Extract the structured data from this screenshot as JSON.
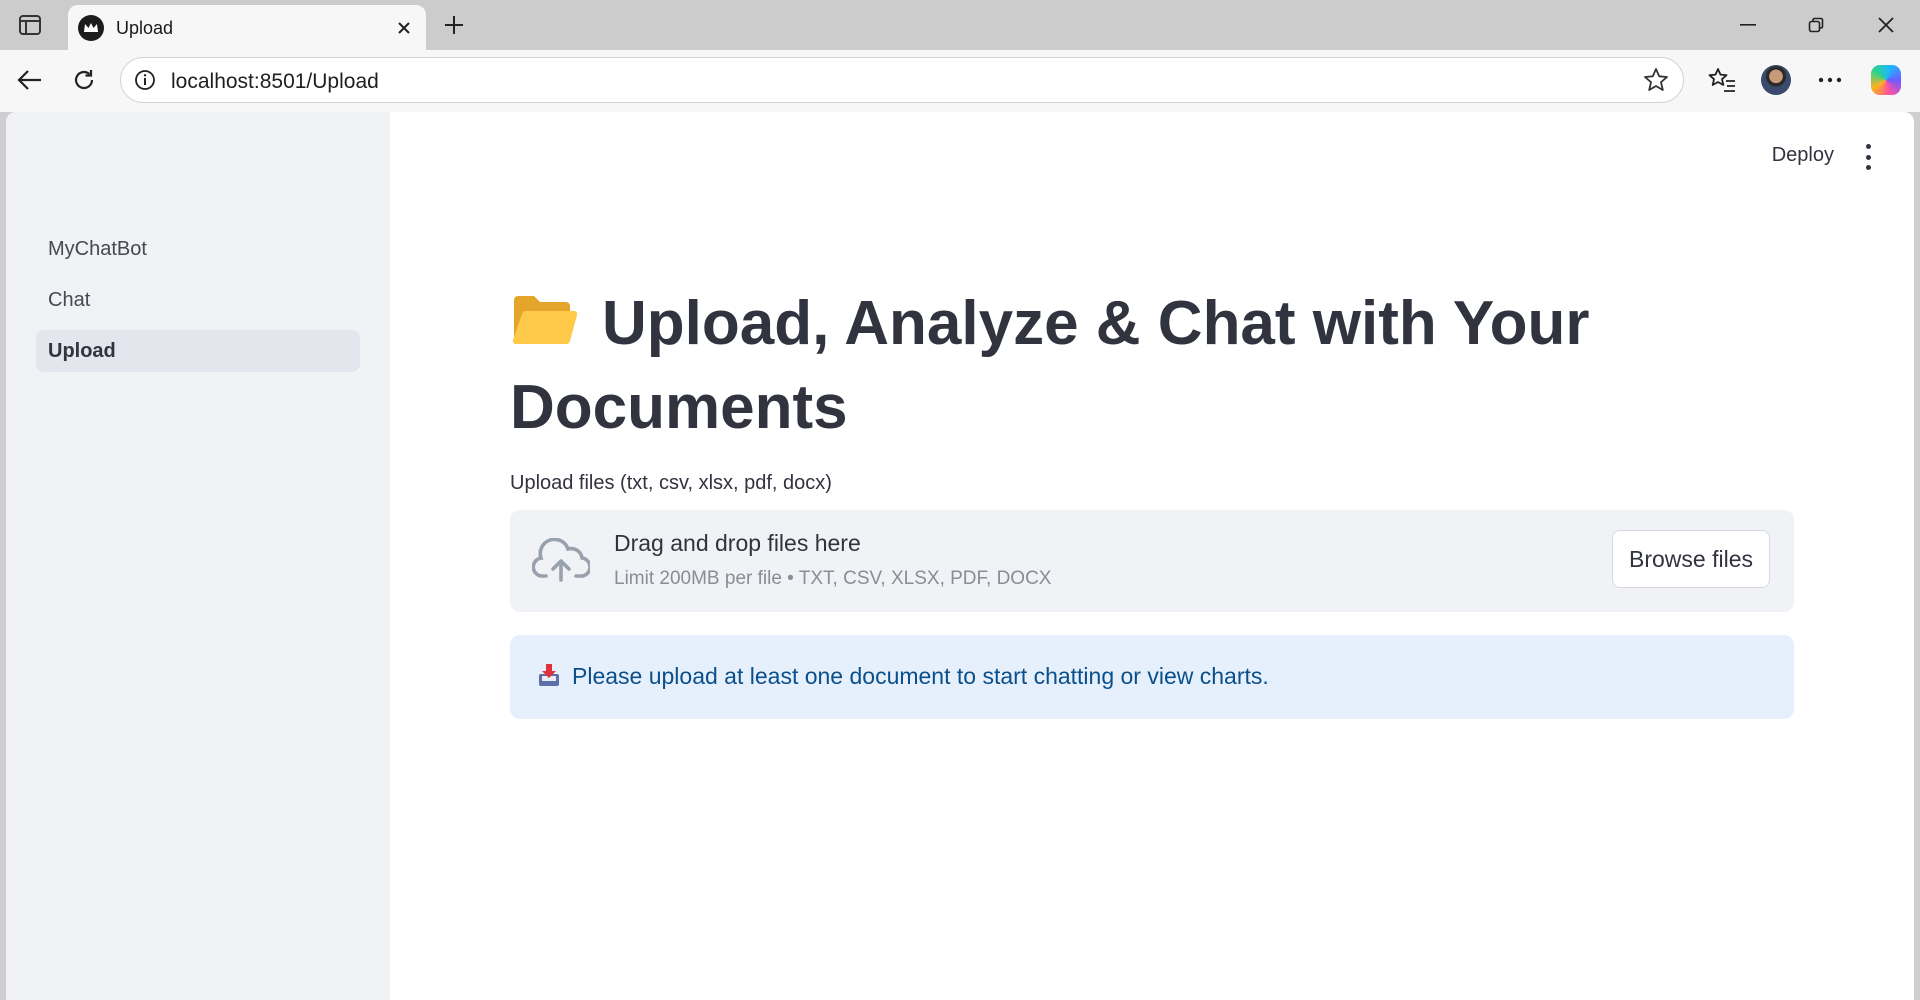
{
  "browser": {
    "tab_title": "Upload",
    "url": "localhost:8501/Upload"
  },
  "sidebar": {
    "items": [
      {
        "label": "MyChatBot",
        "active": false
      },
      {
        "label": "Chat",
        "active": false
      },
      {
        "label": "Upload",
        "active": true
      }
    ]
  },
  "header": {
    "deploy_label": "Deploy"
  },
  "main": {
    "title_icon": "open-folder-icon",
    "title": "Upload, Analyze & Chat with Your Documents",
    "uploader": {
      "label": "Upload files (txt, csv, xlsx, pdf, docx)",
      "drop_title": "Drag and drop files here",
      "drop_limit": "Limit 200MB per file • TXT, CSV, XLSX, PDF, DOCX",
      "browse_label": "Browse files"
    },
    "info": {
      "icon": "inbox-tray-icon",
      "text": "Please upload at least one document to start chatting or view charts."
    }
  },
  "colors": {
    "sidebar_bg": "#f0f2f6",
    "text": "#31333f",
    "info_bg": "#e6f0fc",
    "info_text": "#0b4f8a"
  }
}
